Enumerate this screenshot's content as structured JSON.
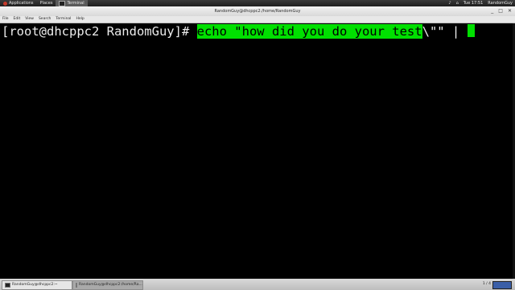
{
  "topbar": {
    "applications": "Applications",
    "places": "Places",
    "terminal": "Terminal",
    "clock": "Tue 17:51",
    "user": "RandomGuy"
  },
  "window": {
    "title": "RandomGuy@dhcppc2:/home/RandomGuy"
  },
  "menu": {
    "items": [
      "File",
      "Edit",
      "View",
      "Search",
      "Terminal",
      "Help"
    ]
  },
  "terminal": {
    "prompt": "[root@dhcppc2 RandomGuy]# ",
    "selected_text": "echo \"how did you do your test",
    "rest_text": "\\\"\" | ",
    "cursor_color": "#00e000"
  },
  "taskbar": {
    "tasks": [
      "RandomGuy@dhcppc2:~",
      "RandomGuy@dhcppc2:/home/Ra..."
    ],
    "workspace": "1 / 4"
  }
}
